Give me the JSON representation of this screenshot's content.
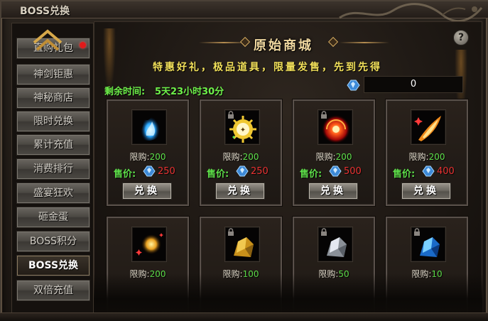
{
  "window": {
    "title": "BOSS兑换"
  },
  "sidebar": {
    "items": [
      {
        "label": "直购礼包",
        "active": false,
        "badge": true
      },
      {
        "label": "神剑钜惠",
        "active": false
      },
      {
        "label": "神秘商店",
        "active": false
      },
      {
        "label": "限时兑换",
        "active": false
      },
      {
        "label": "累计充值",
        "active": false
      },
      {
        "label": "消费排行",
        "active": false
      },
      {
        "label": "盛宴狂欢",
        "active": false
      },
      {
        "label": "砸金蛋",
        "active": false
      },
      {
        "label": "BOSS积分",
        "active": false
      },
      {
        "label": "BOSS兑换",
        "active": true
      },
      {
        "label": "双倍充值",
        "active": false
      }
    ]
  },
  "shop": {
    "title": "原始商城",
    "slogan": "特惠好礼，极品道具，限量发售，先到先得",
    "timer_label": "剩余时间:",
    "timer_value": "5天23小时30分",
    "balance": "0",
    "help_label": "?",
    "limit_label": "限购:",
    "price_label": "售价:",
    "exchange_label": "兑换"
  },
  "items": [
    {
      "icon": "blue-flame-icon",
      "limit": "200",
      "price": "250",
      "locked": false
    },
    {
      "icon": "gold-seal-icon",
      "limit": "200",
      "price": "250",
      "locked": true
    },
    {
      "icon": "red-orb-icon",
      "limit": "200",
      "price": "500",
      "locked": true
    },
    {
      "icon": "fire-blade-icon",
      "limit": "200",
      "price": "400",
      "locked": false
    },
    {
      "icon": "gold-sparkle-icon",
      "limit": "200",
      "locked": false
    },
    {
      "icon": "gold-ore-icon",
      "limit": "100",
      "locked": true
    },
    {
      "icon": "silver-ore-icon",
      "limit": "50",
      "locked": true
    },
    {
      "icon": "blue-ore-icon",
      "limit": "10",
      "locked": true
    }
  ],
  "colors": {
    "green_text": "#5ee04a",
    "price_red": "#e83232",
    "slogan_yellow": "#f2e05a",
    "title_gold": "#f0d8a0"
  }
}
